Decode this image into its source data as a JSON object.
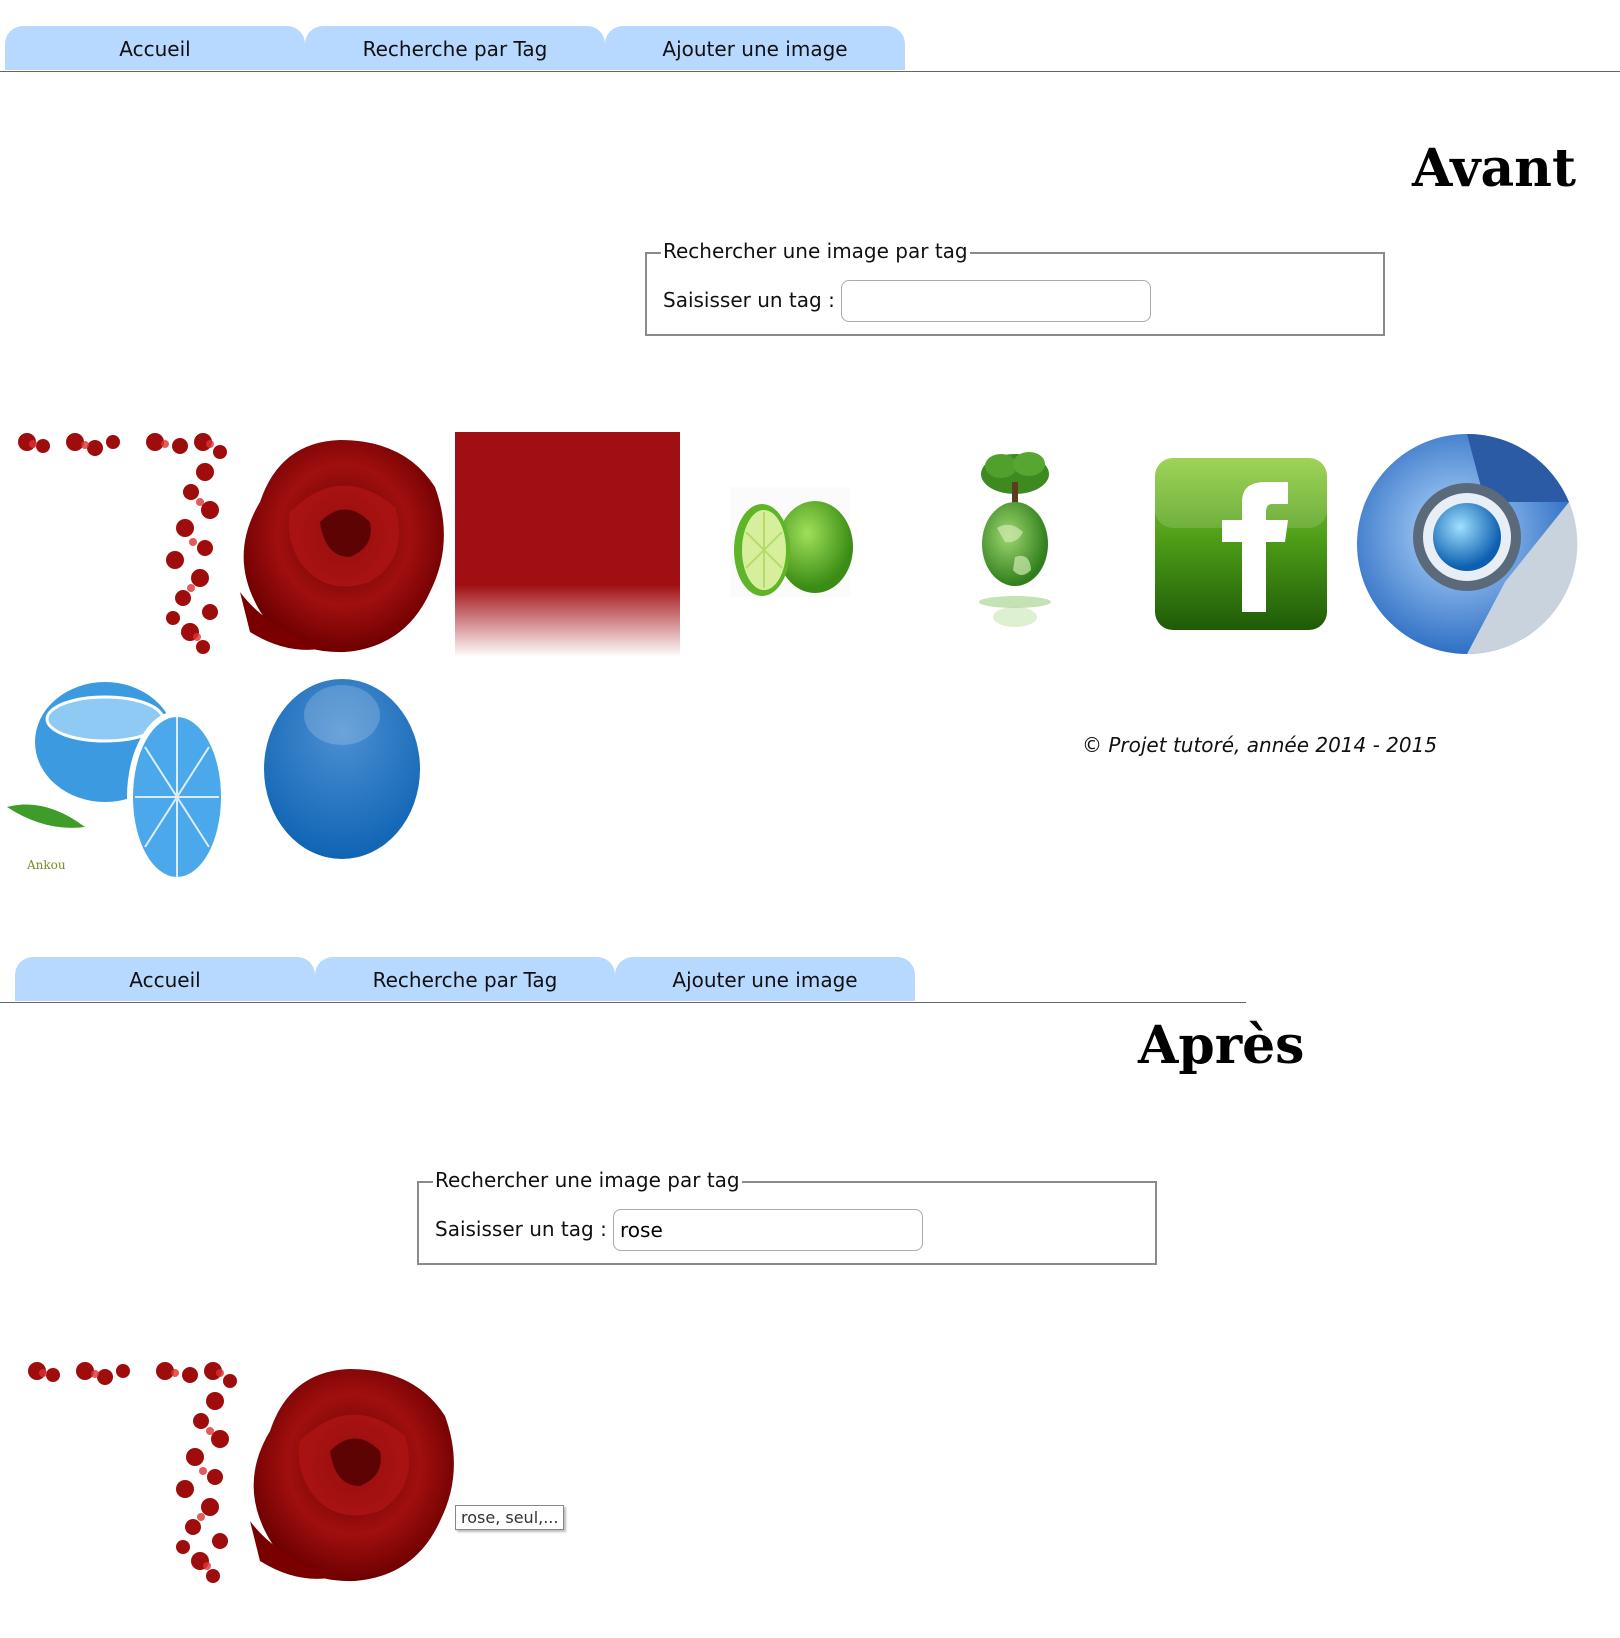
{
  "nav": {
    "tab_home": "Accueil",
    "tab_search": "Recherche par Tag",
    "tab_add": "Ajouter une image"
  },
  "before": {
    "heading": "Avant",
    "search": {
      "legend": "Rechercher une image par tag",
      "label": "Saisisser un tag :",
      "value": ""
    },
    "images": [
      {
        "icon": "rose-border-image"
      },
      {
        "icon": "red-rose-image"
      },
      {
        "icon": "red-gradient-image"
      },
      {
        "icon": "lime-image"
      },
      {
        "icon": "earth-tree-image"
      },
      {
        "icon": "facebook-logo-image"
      },
      {
        "icon": "chrome-logo-image"
      },
      {
        "icon": "blue-orange-image",
        "signature": "Ankou"
      },
      {
        "icon": "blue-ball-image"
      }
    ],
    "footer": "© Projet tutoré, année 2014 - 2015"
  },
  "after": {
    "heading": "Après",
    "search": {
      "legend": "Rechercher une image par tag",
      "label": "Saisisser un tag :",
      "value": "rose"
    },
    "images": [
      {
        "icon": "rose-border-image"
      },
      {
        "icon": "red-rose-image"
      }
    ],
    "tooltip": "rose, seul,..."
  },
  "colors": {
    "tab_bg": "#b7d8ff",
    "rose_red": "#8b0000",
    "lime_green": "#4caf1c",
    "chrome_blue": "#2f6fc4",
    "ball_blue": "#0f64b4"
  }
}
